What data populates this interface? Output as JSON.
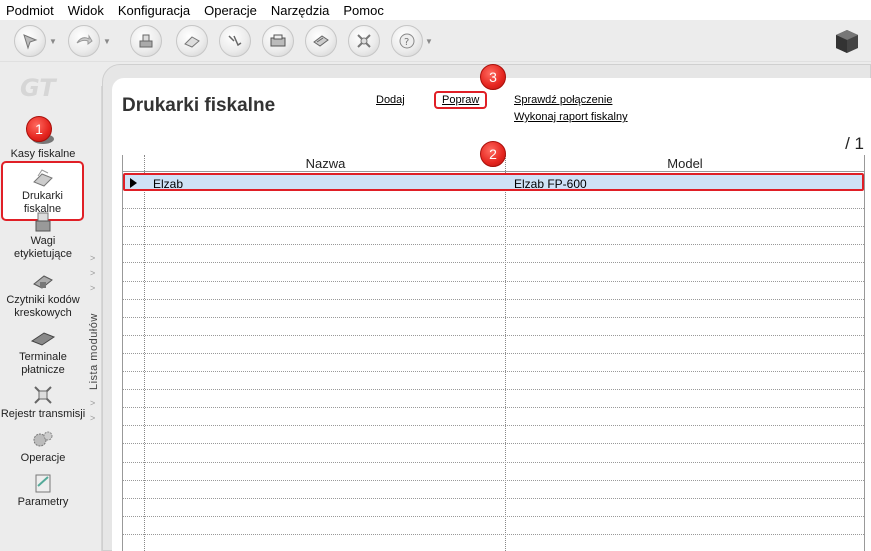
{
  "menu": [
    "Podmiot",
    "Widok",
    "Konfiguracja",
    "Operacje",
    "Narzędzia",
    "Pomoc"
  ],
  "toolbar": {
    "icons": [
      "cursor-icon",
      "forward-icon",
      "fiscal-register-icon",
      "scale-icon",
      "printer-icon",
      "cash-drawer-icon",
      "card-terminal-icon",
      "transmission-icon",
      "help-icon",
      "cube-icon"
    ]
  },
  "sidebar": {
    "items": [
      {
        "label": "Kasy fiskalne"
      },
      {
        "label": "Drukarki fiskalne"
      },
      {
        "label": "Wagi etykietujące"
      },
      {
        "label": "Czytniki kodów kreskowych"
      },
      {
        "label": "Terminale płatnicze"
      },
      {
        "label": "Rejestr transmisji"
      },
      {
        "label": "Operacje"
      },
      {
        "label": "Parametry"
      }
    ],
    "modules_label": "Lista modułów"
  },
  "main": {
    "title": "Drukarki fiskalne",
    "actions": {
      "add": "Dodaj",
      "edit": "Popraw",
      "check": "Sprawdź połączenie",
      "report": "Wykonaj raport fiskalny"
    },
    "page_count": "/ 1",
    "table": {
      "columns": [
        "Nazwa",
        "Model"
      ],
      "rows": [
        {
          "name": "Elzab",
          "model": "Elzab FP-600"
        }
      ]
    }
  },
  "badges": [
    "1",
    "2",
    "3"
  ],
  "colors": {
    "highlight": "#e01f26",
    "selection": "#cfe2f6"
  }
}
